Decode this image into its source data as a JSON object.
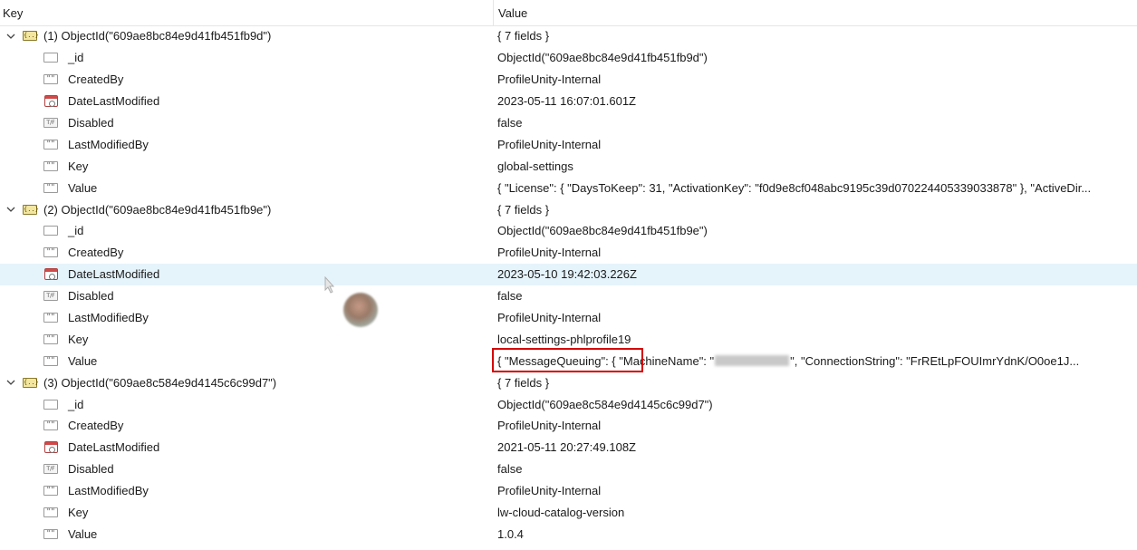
{
  "header": {
    "key_label": "Key",
    "value_label": "Value"
  },
  "colors": {
    "selected_row": "#e5f3fb",
    "highlight_border": "#d40000"
  },
  "documents": [
    {
      "key": "(1) ObjectId(\"609ae8bc84e9d41fb451fb9d\")",
      "value": "{ 7 fields }",
      "fields": [
        {
          "icon": "objectid-icon",
          "key": "_id",
          "value": "ObjectId(\"609ae8bc84e9d41fb451fb9d\")"
        },
        {
          "icon": "string-icon",
          "key": "CreatedBy",
          "value": "ProfileUnity-Internal"
        },
        {
          "icon": "date-icon",
          "key": "DateLastModified",
          "value": "2023-05-11 16:07:01.601Z"
        },
        {
          "icon": "boolean-icon",
          "key": "Disabled",
          "value": "false"
        },
        {
          "icon": "string-icon",
          "key": "LastModifiedBy",
          "value": "ProfileUnity-Internal"
        },
        {
          "icon": "string-icon",
          "key": "Key",
          "value": "global-settings"
        },
        {
          "icon": "string-icon",
          "key": "Value",
          "value": "{ \"License\": { \"DaysToKeep\": 31, \"ActivationKey\": \"f0d9e8cf048abc9195c39d070224405339033878\" }, \"ActiveDir..."
        }
      ]
    },
    {
      "key": "(2) ObjectId(\"609ae8bc84e9d41fb451fb9e\")",
      "value": "{ 7 fields }",
      "fields": [
        {
          "icon": "objectid-icon",
          "key": "_id",
          "value": "ObjectId(\"609ae8bc84e9d41fb451fb9e\")"
        },
        {
          "icon": "string-icon",
          "key": "CreatedBy",
          "value": "ProfileUnity-Internal"
        },
        {
          "icon": "date-icon",
          "key": "DateLastModified",
          "value": "2023-05-10 19:42:03.226Z"
        },
        {
          "icon": "boolean-icon",
          "key": "Disabled",
          "value": "false"
        },
        {
          "icon": "string-icon",
          "key": "LastModifiedBy",
          "value": "ProfileUnity-Internal"
        },
        {
          "icon": "string-icon",
          "key": "Key",
          "value": "local-settings-phlprofile19"
        },
        {
          "icon": "string-icon",
          "key": "Value",
          "value_pre": "{ \"MessageQueuing\": { \"MachineName\": \"",
          "value_post": "\", \"ConnectionString\": \"FrREtLpFOUImrYdnK/O0oe1J..."
        }
      ]
    },
    {
      "key": "(3) ObjectId(\"609ae8c584e9d4145c6c99d7\")",
      "value": "{ 7 fields }",
      "fields": [
        {
          "icon": "objectid-icon",
          "key": "_id",
          "value": "ObjectId(\"609ae8c584e9d4145c6c99d7\")"
        },
        {
          "icon": "string-icon",
          "key": "CreatedBy",
          "value": "ProfileUnity-Internal"
        },
        {
          "icon": "date-icon",
          "key": "DateLastModified",
          "value": "2021-05-11 20:27:49.108Z"
        },
        {
          "icon": "boolean-icon",
          "key": "Disabled",
          "value": "false"
        },
        {
          "icon": "string-icon",
          "key": "LastModifiedBy",
          "value": "ProfileUnity-Internal"
        },
        {
          "icon": "string-icon",
          "key": "Key",
          "value": "lw-cloud-catalog-version"
        },
        {
          "icon": "string-icon",
          "key": "Value",
          "value": "1.0.4"
        }
      ]
    }
  ],
  "icon_glyphs": {
    "document": "{..}",
    "string": "\"\"",
    "boolean": "T/F"
  }
}
